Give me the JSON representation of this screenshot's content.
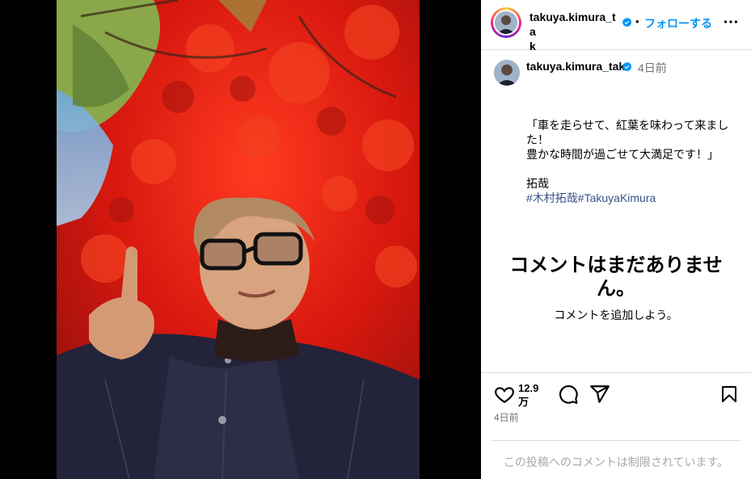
{
  "post": {
    "username": "takuya.kimura_tak",
    "username_wrapped": "takuya.kimura_ta\nk",
    "follow_label": "フォローする",
    "separator": "•",
    "time_ago": "4日前",
    "caption_lines": [
      "「車を走らせて、紅葉を味わって来まし",
      "た！",
      "豊かな時間が過ごせて大満足です！」",
      "",
      "拓哉"
    ],
    "hashtags": [
      "#木村拓哉",
      "#TakuyaKimura"
    ]
  },
  "comments": {
    "empty_title": "コメントはまだありません。",
    "empty_subtitle": "コメントを追加しよう。"
  },
  "actions": {
    "like_count": "12.9万",
    "post_time": "4日前",
    "restricted_notice": "この投稿へのコメントは制限されています。"
  },
  "icons": {
    "verified": "verified-badge-icon",
    "more": "more-options-icon",
    "like": "heart-icon",
    "comment": "comment-icon",
    "share": "share-icon",
    "save": "bookmark-icon"
  },
  "colors": {
    "accent": "#0095f6",
    "hashtag": "#385185",
    "muted": "#737373",
    "divider": "#dbdbdb"
  }
}
